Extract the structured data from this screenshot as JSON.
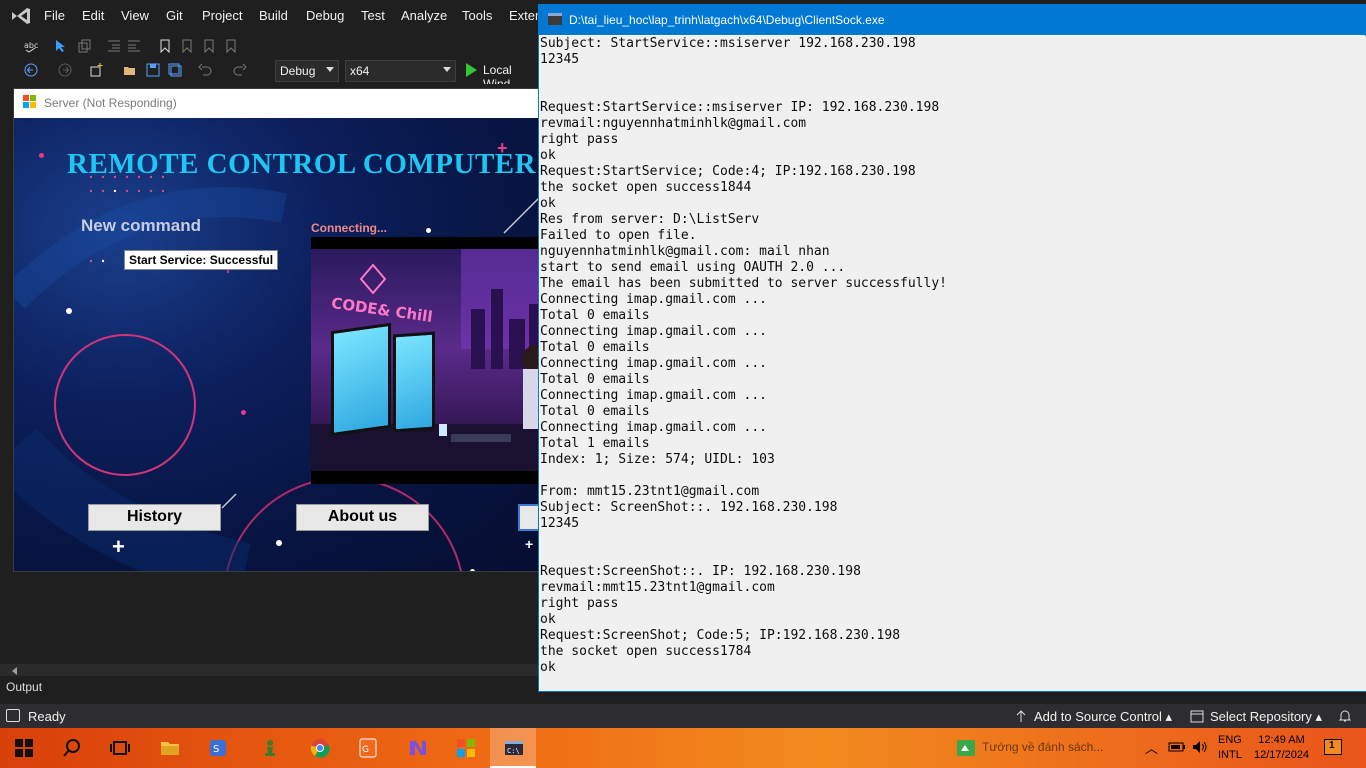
{
  "vs": {
    "menu": [
      "File",
      "Edit",
      "View",
      "Git",
      "Project",
      "Build",
      "Debug",
      "Test",
      "Analyze",
      "Tools",
      "Exten"
    ],
    "config_combo": "Debug",
    "platform_combo": "x64",
    "run_label": "Local Wind",
    "output_label": "Output",
    "status_ready": "Ready",
    "add_source_control": "Add to Source Control",
    "select_repository": "Select Repository"
  },
  "server": {
    "title": "Server (Not Responding)",
    "heading": "REMOTE CONTROL COMPUTER BY",
    "new_command": "New command",
    "status_box": "Start Service: Successful",
    "connecting": "Connecting...",
    "video_sign": "CODE& Chill",
    "buttons": {
      "history": "History",
      "about": "About us"
    }
  },
  "console": {
    "title": "D:\\tai_lieu_hoc\\lap_trinh\\latgach\\x64\\Debug\\ClientSock.exe",
    "lines": [
      "Subject: StartService::msiserver 192.168.230.198",
      "12345",
      "",
      "",
      "Request:StartService::msiserver IP: 192.168.230.198",
      "revmail:nguyennhatminhlk@gmail.com",
      "right pass",
      "ok",
      "Request:StartService; Code:4; IP:192.168.230.198",
      "the socket open success1844",
      "ok",
      "Res from server: D:\\ListServ",
      "Failed to open file.",
      "nguyennhatminhlk@gmail.com: mail nhan",
      "start to send email using OAUTH 2.0 ...",
      "The email has been submitted to server successfully!",
      "Connecting imap.gmail.com ...",
      "Total 0 emails",
      "Connecting imap.gmail.com ...",
      "Total 0 emails",
      "Connecting imap.gmail.com ...",
      "Total 0 emails",
      "Connecting imap.gmail.com ...",
      "Total 0 emails",
      "Connecting imap.gmail.com ...",
      "Total 1 emails",
      "Index: 1; Size: 574; UIDL: 103",
      "",
      "From: mmt15.23tnt1@gmail.com",
      "Subject: ScreenShot::. 192.168.230.198",
      "12345",
      "",
      "",
      "Request:ScreenShot::. IP: 192.168.230.198",
      "revmail:mmt15.23tnt1@gmail.com",
      "right pass",
      "ok",
      "Request:ScreenShot; Code:5; IP:192.168.230.198",
      "the socket open success1784",
      "ok"
    ]
  },
  "taskbar": {
    "weather": "Tướng về đánh sách...",
    "lang_top": "ENG",
    "lang_bottom": "INTL",
    "time": "12:49 AM",
    "date": "12/17/2024",
    "notif_count": "1"
  },
  "colors": {
    "vs_bg": "#1f1f1f",
    "console_accent": "#0078d4",
    "heading_cyan": "#1ec7f2",
    "taskbar_orange": "#ef6a14"
  }
}
